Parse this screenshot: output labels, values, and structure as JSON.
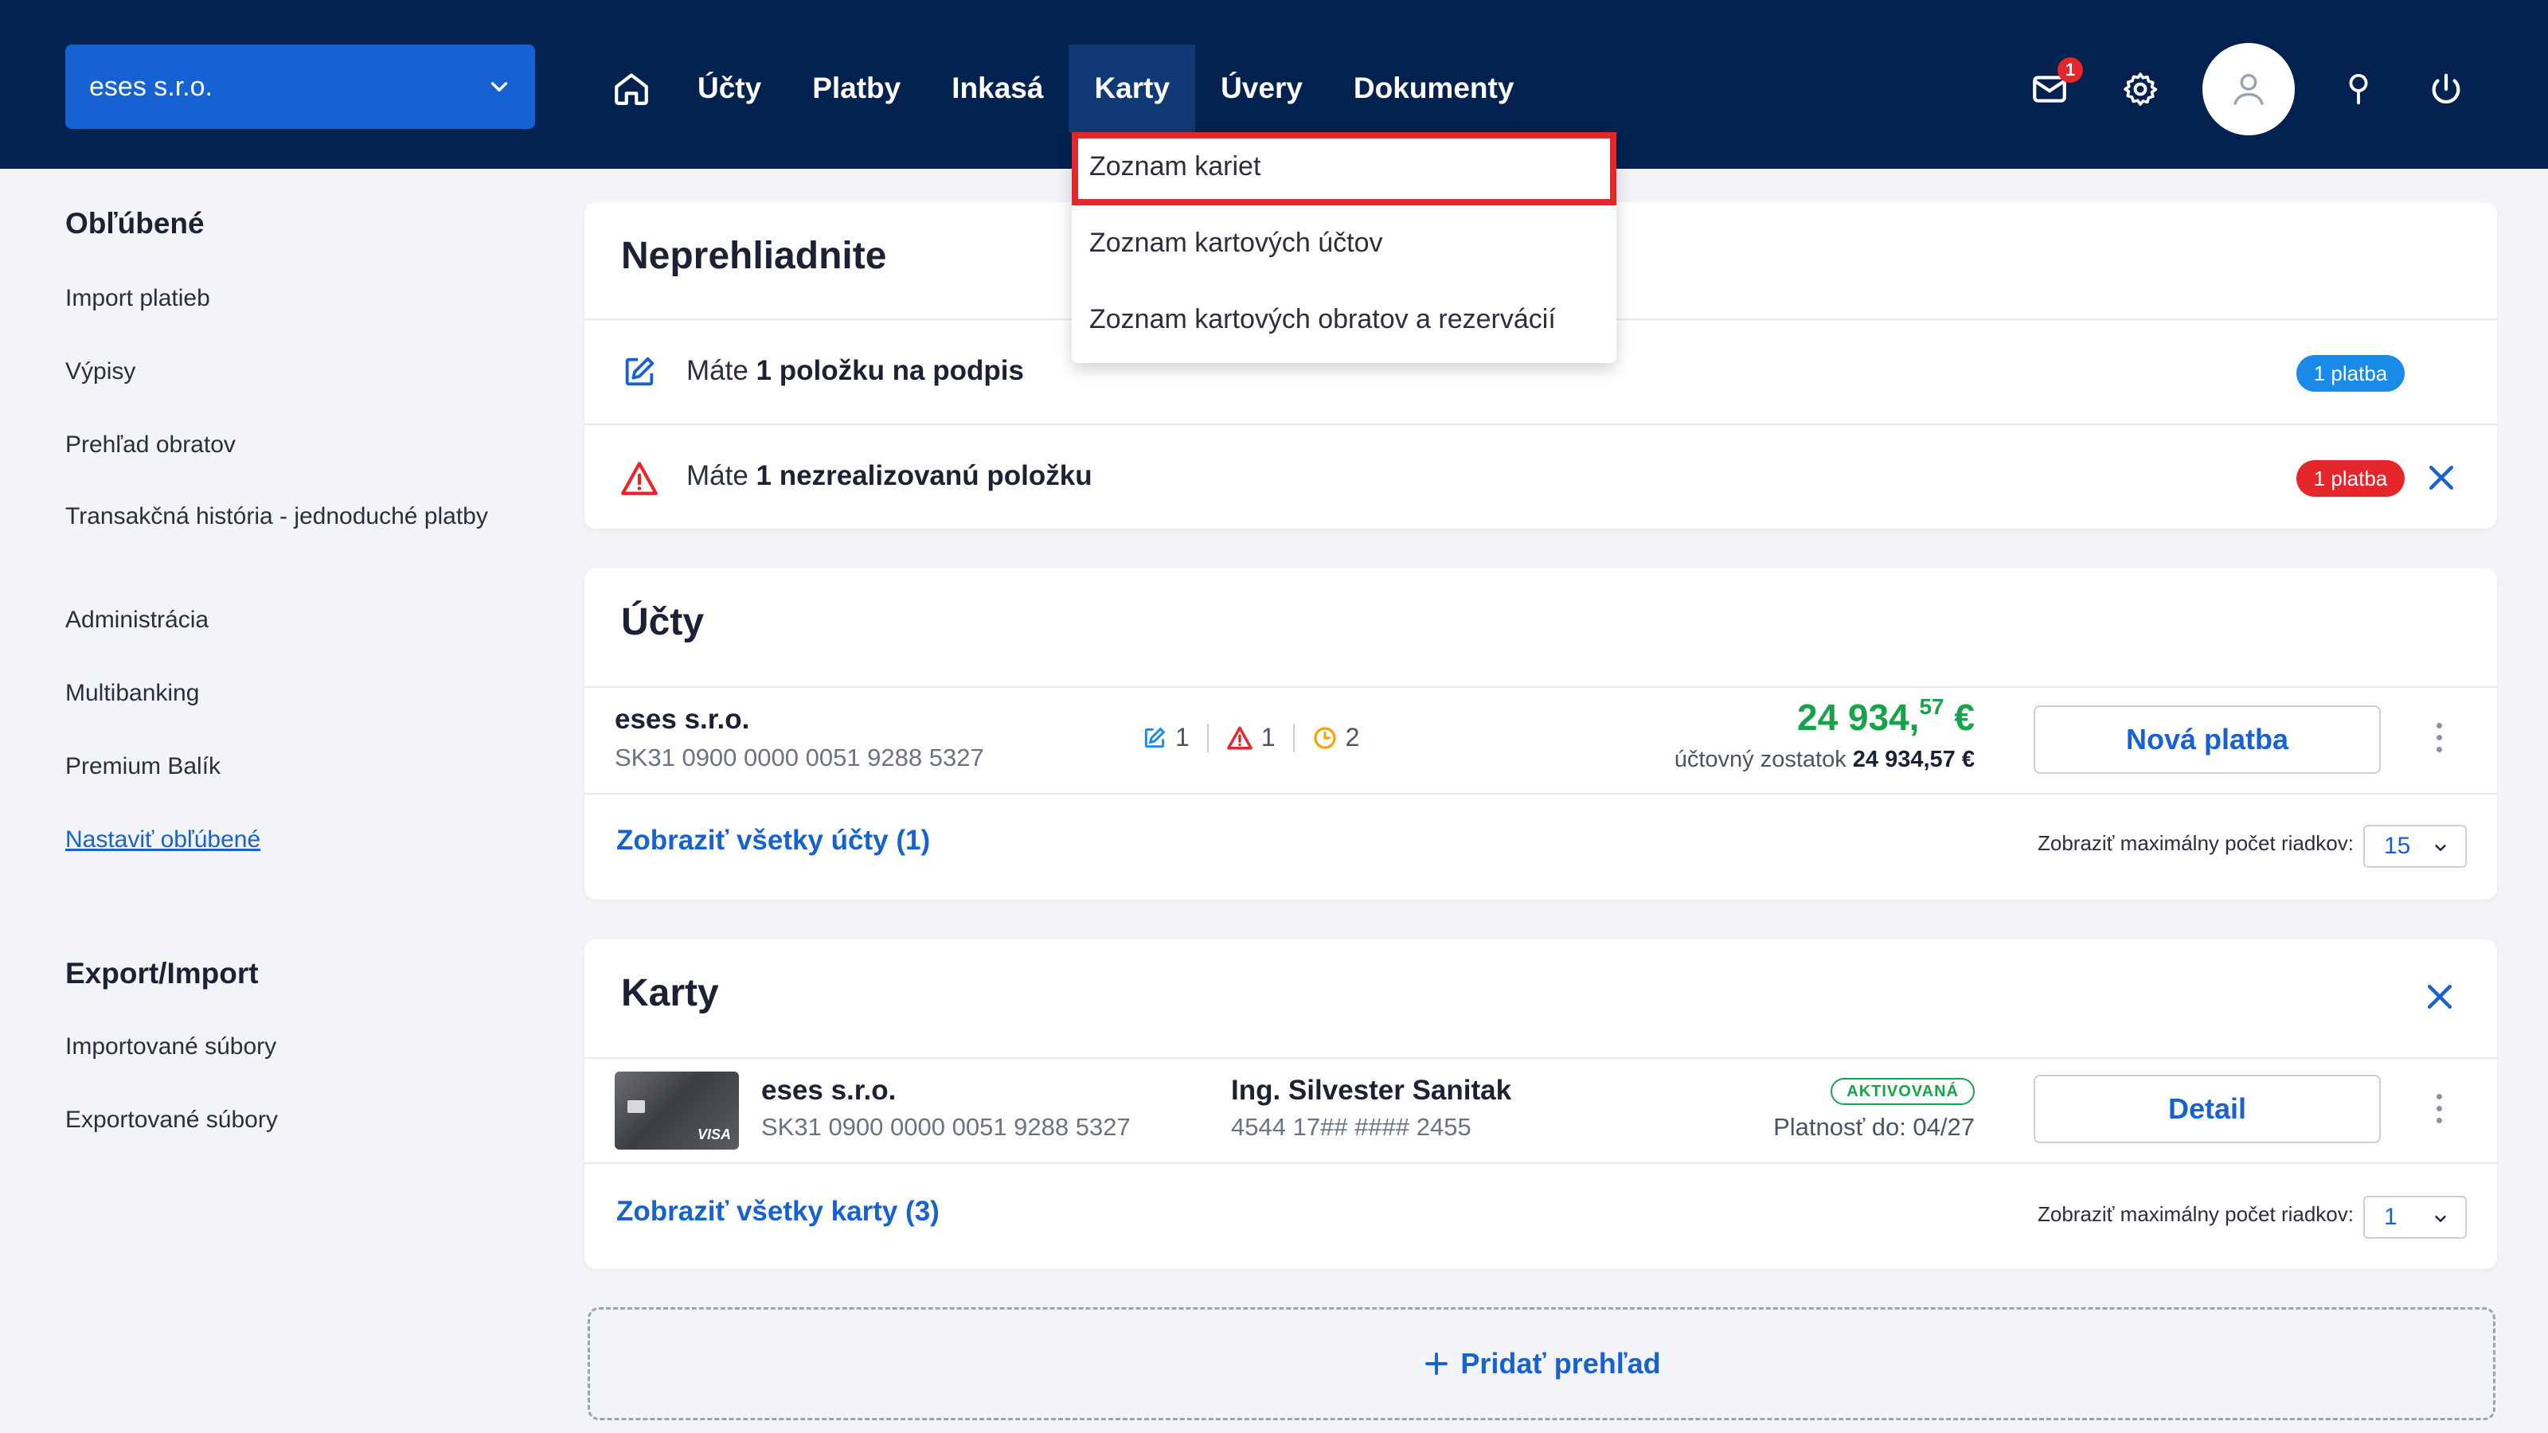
{
  "header": {
    "company": "eses s.r.o.",
    "nav": [
      {
        "label": "Účty"
      },
      {
        "label": "Platby"
      },
      {
        "label": "Inkasá"
      },
      {
        "label": "Karty"
      },
      {
        "label": "Úvery"
      },
      {
        "label": "Dokumenty"
      }
    ],
    "active_nav": "Karty",
    "mail_badge": "1"
  },
  "dropdown": {
    "items": [
      "Zoznam kariet",
      "Zoznam kartových účtov",
      "Zoznam kartových obratov a rezervácií"
    ]
  },
  "sidebar": {
    "favorites_heading": "Obľúbené",
    "favorites": [
      "Import platieb",
      "Výpisy",
      "Prehľad obratov",
      "Transakčná história - jednoduché platby",
      "Administrácia",
      "Multibanking",
      "Premium Balík"
    ],
    "favorites_link": "Nastaviť obľúbené",
    "export_heading": "Export/Import",
    "export_items": [
      "Importované súbory",
      "Exportované súbory"
    ]
  },
  "notices": {
    "title": "Neprehliadnite",
    "rows": [
      {
        "prefix": "Máte ",
        "bold": "1 položku na podpis",
        "badge": "1 platba",
        "badge_color": "#1a8ae8"
      },
      {
        "prefix": "Máte ",
        "bold": "1 nezrealizovanú položku",
        "badge": "1 platba",
        "badge_color": "#e5262a"
      }
    ]
  },
  "accounts": {
    "title": "Účty",
    "name": "eses s.r.o.",
    "iban": "SK31 0900 0000 0051 9288 5327",
    "sign_count": "1",
    "warn_count": "1",
    "pending_count": "2",
    "balance_main": "24 934,",
    "balance_cents": "57",
    "balance_currency": " €",
    "balance_label": "účtovný zostatok ",
    "balance_value": "24 934,57 €",
    "new_payment": "Nová platba",
    "show_all": "Zobraziť všetky účty (1)",
    "rows_label": "Zobraziť maximálny počet riadkov:",
    "rows_value": "15"
  },
  "cards": {
    "title": "Karty",
    "name": "eses s.r.o.",
    "iban": "SK31 0900 0000 0051 9288 5327",
    "holder": "Ing. Silvester Sanitak",
    "number": "4544 17## #### 2455",
    "status": "AKTIVOVANÁ",
    "validity": "Platnosť do: 04/27",
    "detail": "Detail",
    "brand": "VISA",
    "show_all": "Zobraziť všetky karty (3)",
    "rows_label": "Zobraziť maximálny počet riadkov:",
    "rows_value": "1"
  },
  "add_overview": "Pridať prehľad"
}
